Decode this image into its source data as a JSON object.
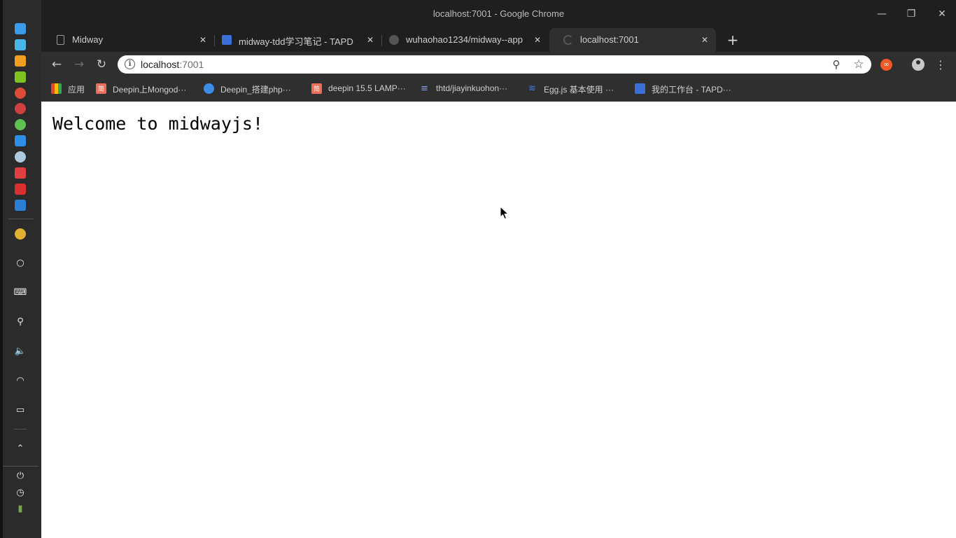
{
  "window": {
    "title": "localhost:7001 - Google Chrome",
    "controls": {
      "minimize": "—",
      "restore": "❐",
      "close": "✕"
    }
  },
  "tabs": [
    {
      "label": "Midway",
      "icon": "document-icon",
      "active": false
    },
    {
      "label": "midway-tdd学习笔记 - TAPD",
      "icon": "tapd-icon",
      "active": false
    },
    {
      "label": "wuhaohao1234/midway--app",
      "icon": "github-icon",
      "active": false
    },
    {
      "label": "localhost:7001",
      "icon": "loading-icon",
      "active": true
    }
  ],
  "toolbar": {
    "back": "←",
    "forward": "→",
    "reload": "↻",
    "url_host": "localhost",
    "url_port": ":7001",
    "zoom": "⚲",
    "star": "☆",
    "menu": "⋮"
  },
  "bookmarks": [
    {
      "label": "应用",
      "icon": "apps-grid-icon",
      "color": "#e94235"
    },
    {
      "label": "Deepin上Mongod···",
      "icon": "jianshu-icon",
      "icon_text": "简",
      "color": "#ea6f5a"
    },
    {
      "label": "Deepin_搭建php···",
      "icon": "deepin-icon",
      "icon_text": "",
      "color": "#3b8ee8"
    },
    {
      "label": "deepin 15.5 LAMP···",
      "icon": "jianshu-icon",
      "icon_text": "简",
      "color": "#ea6f5a"
    },
    {
      "label": "thtd/jiayinkuohon···",
      "icon": "git-icon",
      "icon_text": "≡",
      "color": "#5f7fbf"
    },
    {
      "label": "Egg.js 基本使用 ···",
      "icon": "egg-icon",
      "icon_text": "≋",
      "color": "#2f6bd8"
    },
    {
      "label": "我的工作台 - TAPD···",
      "icon": "tapd-icon",
      "icon_text": "",
      "color": "#3b6fd8"
    }
  ],
  "page": {
    "heading": "Welcome to midwayjs!"
  },
  "dock": {
    "apps": [
      {
        "name": "deepin-launcher",
        "color": "#3b9be8"
      },
      {
        "name": "file-manager",
        "color": "#4ab6e8"
      },
      {
        "name": "app-store",
        "color": "#f0a020"
      },
      {
        "name": "music-player",
        "color": "#7ec322"
      },
      {
        "name": "chrome",
        "color": "#dd4b39"
      },
      {
        "name": "settings",
        "color": "#d04040"
      },
      {
        "name": "wechat",
        "color": "#5cc150"
      },
      {
        "name": "mail",
        "color": "#2f8fe8"
      },
      {
        "name": "browser",
        "color": "#b0c8e0"
      },
      {
        "name": "screen-recorder",
        "color": "#e04040"
      },
      {
        "name": "terminal",
        "color": "#d83030"
      },
      {
        "name": "vscode",
        "color": "#2a7fd4"
      },
      {
        "name": "chrome-2",
        "color": "#e0b030"
      }
    ],
    "tray": {
      "circle": "○",
      "keyboard": "⌨",
      "usb": "⚲",
      "volume": "🔈",
      "wifi": "◠",
      "battery": "▭",
      "expand": "⌃",
      "power": "⏻",
      "clock": "◷",
      "trash": "▮"
    }
  }
}
